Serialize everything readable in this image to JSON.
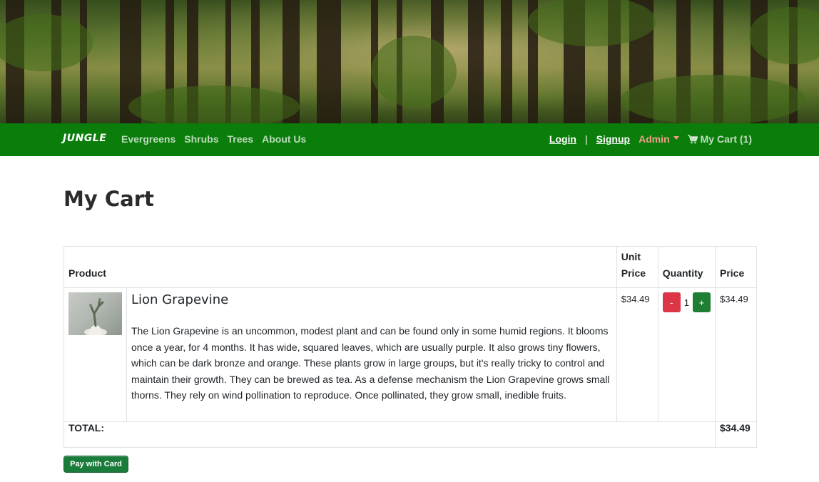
{
  "brand": "JUNGLE",
  "nav": {
    "links": [
      "Evergreens",
      "Shrubs",
      "Trees",
      "About Us"
    ],
    "login": "Login",
    "separator": "|",
    "signup": "Signup",
    "admin": "Admin",
    "cart": "My Cart (1)"
  },
  "page": {
    "title": "My Cart"
  },
  "table": {
    "headers": {
      "product": "Product",
      "unit_price": "Unit Price",
      "quantity": "Quantity",
      "price": "Price"
    },
    "items": [
      {
        "name": "Lion Grapevine",
        "description": "The Lion Grapevine is an uncommon, modest plant and can be found only in some humid regions. It blooms once a year, for 4 months. It has wide, squared leaves, which are usually purple. It also grows tiny flowers, which can be dark bronze and orange. These plants grow in large groups, but it's really tricky to control and maintain their growth. They can be brewed as tea. As a defense mechanism the Lion Grapevine grows small thorns. They rely on wind pollination to reproduce. Once pollinated, they grow small, inedible fruits.",
        "unit_price": "$34.49",
        "quantity": "1",
        "minus": "-",
        "plus": "+",
        "price": "$34.49"
      }
    ],
    "total_label": "TOTAL:",
    "total_value": "$34.49"
  },
  "pay_button": "Pay with Card",
  "colors": {
    "navbar": "#0a7d0a",
    "admin": "#f3a08a",
    "minus": "#dc3545",
    "plus": "#1e7e34"
  },
  "icons": {
    "cart": "cart-icon",
    "admin_caret": "caret-down-icon"
  }
}
